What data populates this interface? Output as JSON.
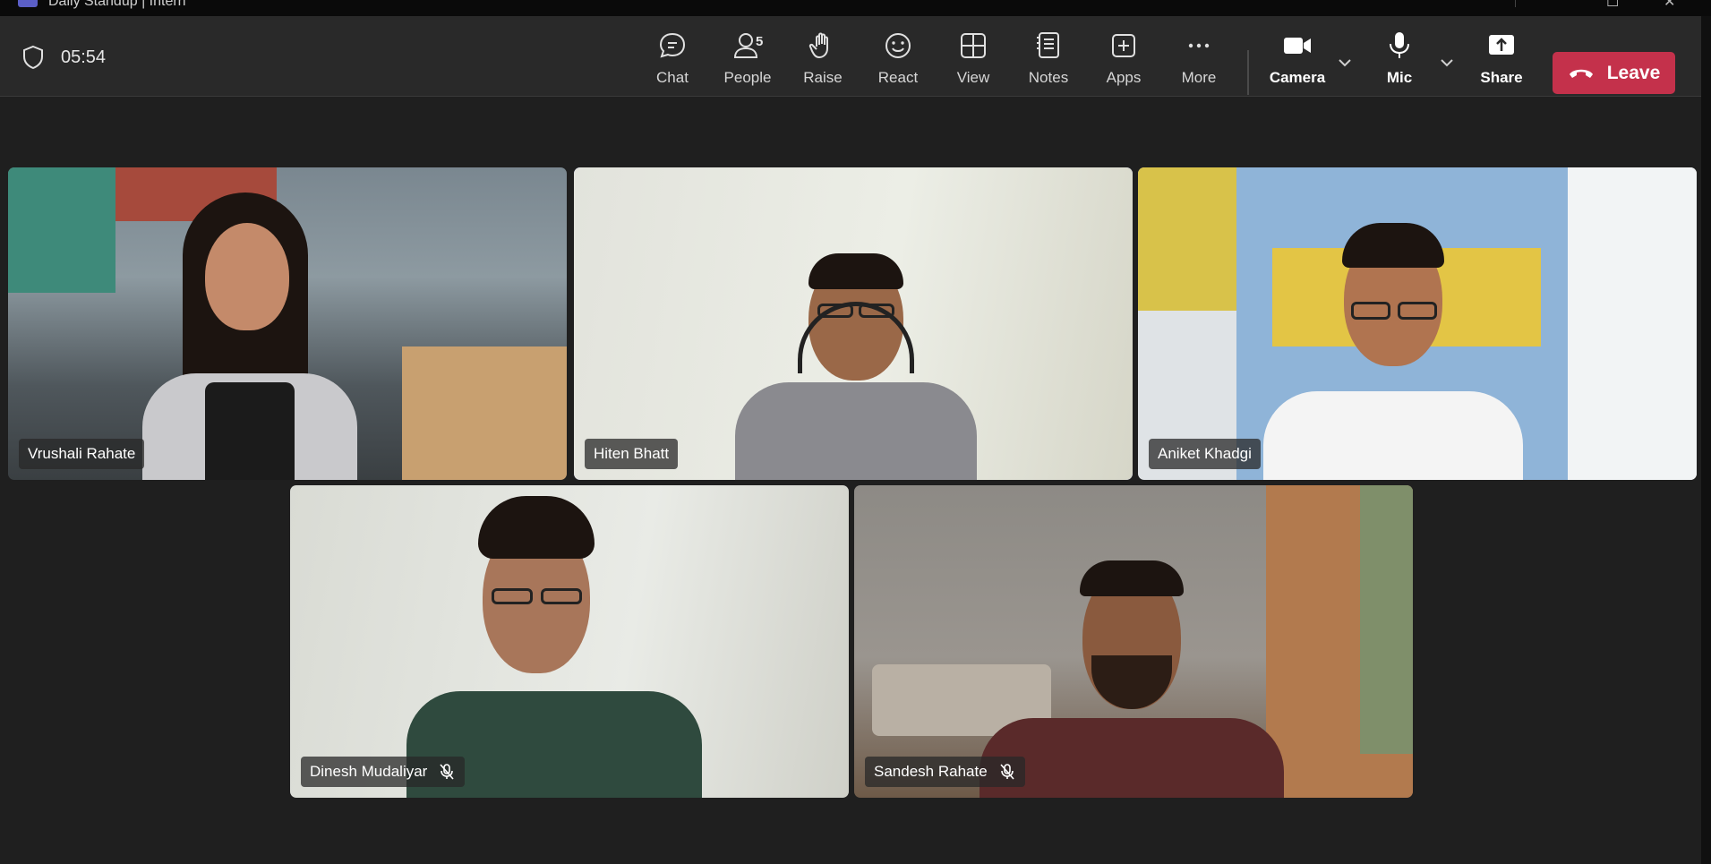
{
  "window": {
    "title": "Daily Standup | Intern"
  },
  "meeting": {
    "timer": "05:54"
  },
  "toolbar": {
    "chat": "Chat",
    "people": "People",
    "people_count": "5",
    "raise": "Raise",
    "react": "React",
    "view": "View",
    "notes": "Notes",
    "apps": "Apps",
    "more": "More",
    "camera": "Camera",
    "mic": "Mic",
    "share": "Share",
    "leave": "Leave"
  },
  "colors": {
    "leave": "#c4314b",
    "speaking_border": "#7f85f5",
    "toolbar_bg": "#292929",
    "stage_bg": "#1f1f1f"
  },
  "participants": [
    {
      "name": "Vrushali Rahate",
      "muted": false,
      "speaking": false
    },
    {
      "name": "Hiten Bhatt",
      "muted": false,
      "speaking": true
    },
    {
      "name": "Aniket Khadgi",
      "muted": false,
      "speaking": false
    },
    {
      "name": "Dinesh Mudaliyar",
      "muted": true,
      "speaking": false
    },
    {
      "name": "Sandesh Rahate",
      "muted": true,
      "speaking": false
    }
  ]
}
